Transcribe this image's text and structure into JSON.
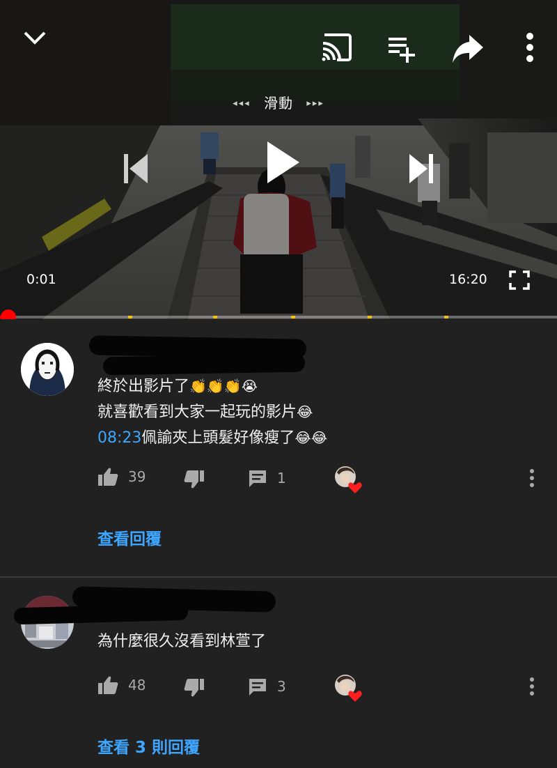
{
  "player": {
    "scrub_arrows_left": "◂◂◂",
    "scrub_label": "滑動",
    "scrub_arrows_right": "▸▸▸",
    "current_time": "0:01",
    "duration": "16:20",
    "progress_fraction": 0.0,
    "icons": [
      "chevron-down-icon",
      "cast-icon",
      "add-to-queue-icon",
      "share-icon",
      "more-vert-icon",
      "previous-icon",
      "play-icon",
      "next-icon",
      "fullscreen-icon"
    ],
    "colors": {
      "progress": "#ff0000",
      "ad_marker": "#f4c20d"
    }
  },
  "comments": [
    {
      "lines": [
        {
          "text": "終於出影片了",
          "emoji": "👏👏👏😭"
        },
        {
          "text": "就喜歡看到大家一起玩的影片",
          "emoji": "😂"
        },
        {
          "timestamp": "08:23",
          "text": "佩諭夾上頭髮好像瘦了",
          "emoji": "😂😂"
        }
      ],
      "likes": "39",
      "replies_count": "1",
      "view_replies": "查看回覆"
    },
    {
      "lines": [
        {
          "text": "為什麼很久沒看到林萱了"
        }
      ],
      "likes": "48",
      "replies_count": "3",
      "view_replies": "查看 3 則回覆"
    }
  ],
  "colors": {
    "background": "#212121",
    "link": "#3ea6ff",
    "text": "#f1f1f1",
    "secondary": "#aaaaaa",
    "heart": "#ff0000"
  }
}
